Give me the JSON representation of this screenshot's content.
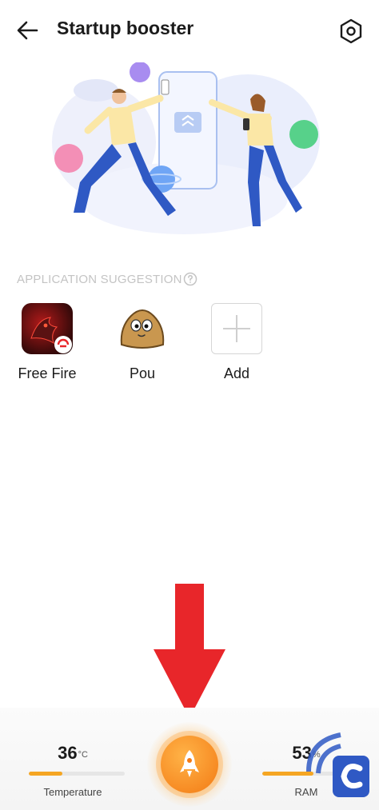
{
  "header": {
    "title": "Startup booster",
    "back_icon": "back-arrow-icon",
    "settings_icon": "settings-hexagon-icon"
  },
  "section": {
    "label": "APPLICATION SUGGESTION",
    "help_icon": "question-circle-icon"
  },
  "apps": [
    {
      "label": "Free Fire",
      "icon": "free-fire-app-icon"
    },
    {
      "label": "Pou",
      "icon": "pou-app-icon"
    },
    {
      "label": "Add",
      "icon": "plus-icon"
    }
  ],
  "stats": {
    "temperature": {
      "value": "36",
      "unit": "°C",
      "label": "Temperature",
      "level": 0.35
    },
    "ram": {
      "value": "53",
      "unit": "%",
      "label": "RAM",
      "level": 0.53
    }
  },
  "boost_button": {
    "icon": "rocket-icon"
  },
  "colors": {
    "accent": "#f5a623",
    "boost": "#f37a14",
    "annotation_arrow": "#e8262a",
    "section_label": "#c4c4c4"
  }
}
